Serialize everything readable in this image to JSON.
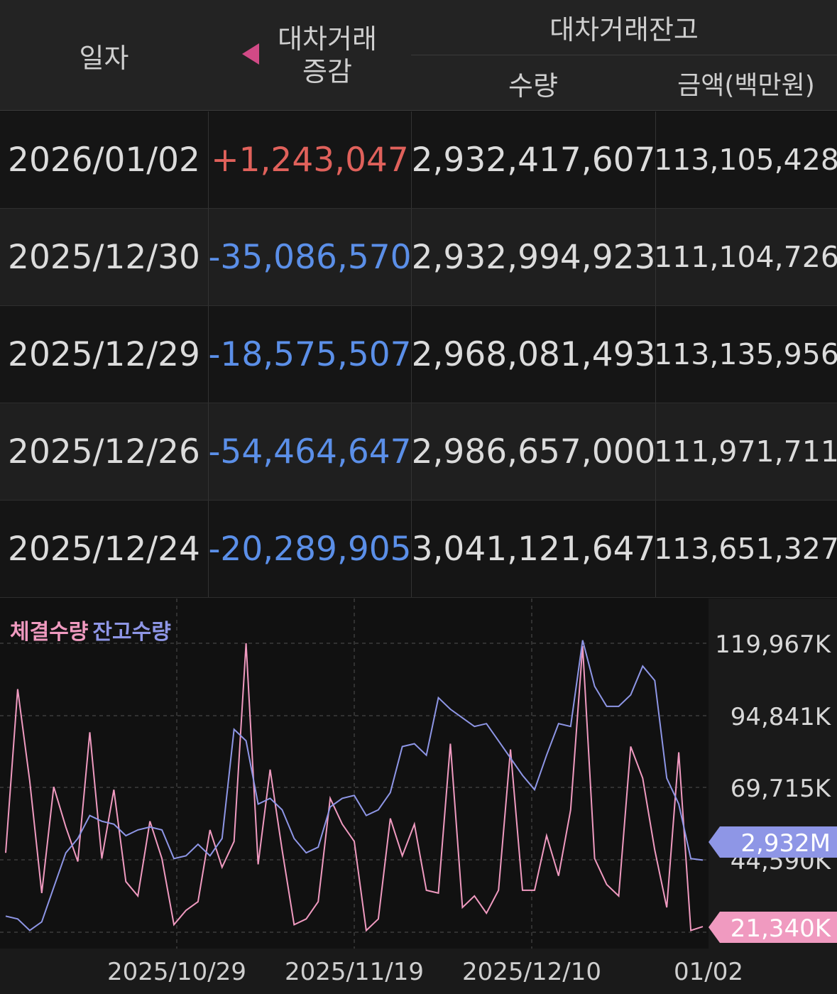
{
  "header": {
    "date": "일자",
    "change_line1": "대차거래",
    "change_line2": "증감",
    "balance": "대차거래잔고",
    "qty": "수량",
    "amount": "금액(백만원)"
  },
  "rows": [
    {
      "date": "2026/01/02",
      "change": "+1,243,047",
      "qty": "2,932,417,607",
      "amount": "113,105,428"
    },
    {
      "date": "2025/12/30",
      "change": "-35,086,570",
      "qty": "2,932,994,923",
      "amount": "111,104,726"
    },
    {
      "date": "2025/12/29",
      "change": "-18,575,507",
      "qty": "2,968,081,493",
      "amount": "113,135,956"
    },
    {
      "date": "2025/12/26",
      "change": "-54,464,647",
      "qty": "2,986,657,000",
      "amount": "111,971,711"
    },
    {
      "date": "2025/12/24",
      "change": "-20,289,905",
      "qty": "3,041,121,647",
      "amount": "113,651,327"
    }
  ],
  "colors": {
    "positive": "#e0615b",
    "negative": "#5b8fe8",
    "volume": "#f09ac0",
    "balance": "#8e96e6"
  },
  "chart_data": {
    "type": "line",
    "legend": [
      "체결수량",
      "잔고수량"
    ],
    "y_ticks": [
      "119,967K",
      "94,841K",
      "69,715K",
      "44,590K"
    ],
    "y_tick_values": [
      119967,
      94841,
      69715,
      44590
    ],
    "x_ticks": [
      "2025/10/29",
      "2025/11/19",
      "2025/12/10",
      "01/02"
    ],
    "current_balance_label": "2,932M",
    "current_volume_label": "21,340K",
    "series": [
      {
        "name": "체결수량",
        "values": [
          47000,
          104000,
          72000,
          33000,
          70000,
          56000,
          44000,
          89000,
          45000,
          69000,
          37000,
          32000,
          58000,
          45000,
          22000,
          27000,
          30000,
          55000,
          42000,
          51000,
          120000,
          43000,
          76000,
          48000,
          22000,
          24000,
          30000,
          66000,
          57000,
          51000,
          20000,
          24000,
          59000,
          46000,
          57000,
          34000,
          33000,
          85000,
          28000,
          32000,
          26000,
          34000,
          83000,
          34000,
          34000,
          53000,
          39000,
          62000,
          119000,
          45000,
          36000,
          32000,
          84000,
          73000,
          48000,
          28000,
          82000,
          20000,
          21340
        ]
      },
      {
        "name": "잔고수량",
        "values": [
          25000,
          24000,
          20000,
          23000,
          35000,
          47000,
          52000,
          60000,
          58000,
          57000,
          53000,
          55000,
          56000,
          55000,
          45000,
          46000,
          50000,
          46000,
          52000,
          90000,
          86000,
          64000,
          66000,
          62000,
          52000,
          47000,
          49000,
          63000,
          66000,
          67000,
          60000,
          62000,
          68000,
          84000,
          85000,
          81000,
          101000,
          97000,
          94000,
          91000,
          92000,
          86000,
          80000,
          74000,
          69000,
          81000,
          92000,
          91000,
          121000,
          105000,
          98000,
          98000,
          102000,
          112000,
          107000,
          73000,
          64000,
          45000,
          44500
        ]
      }
    ]
  }
}
